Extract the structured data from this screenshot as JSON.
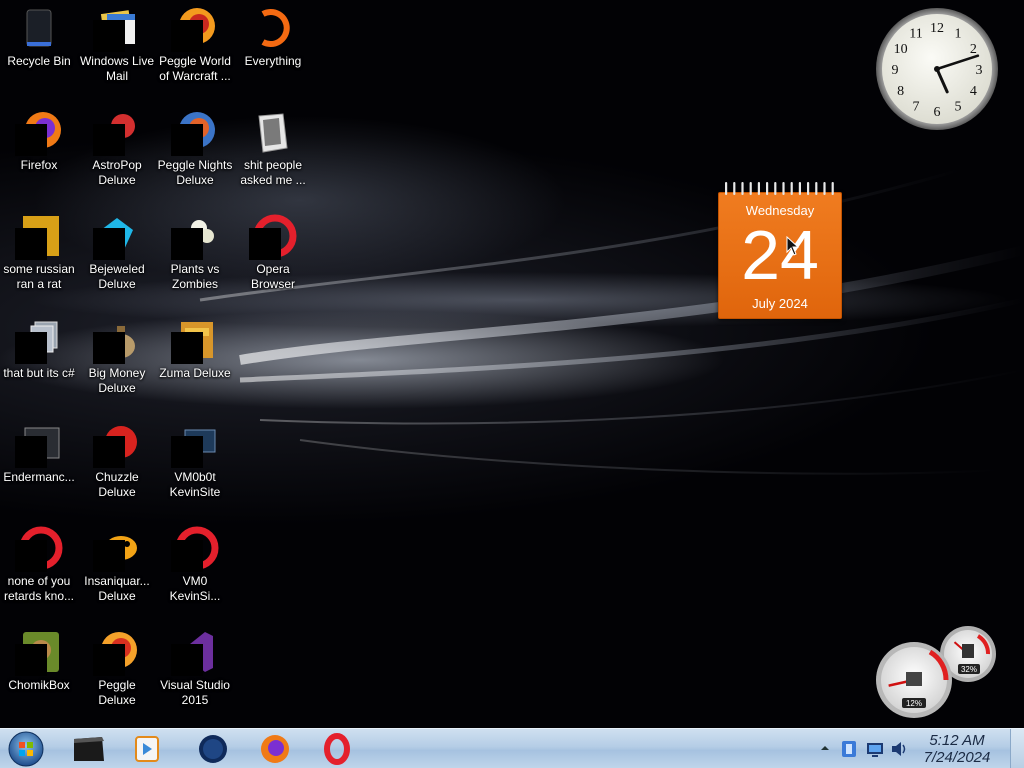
{
  "desktop": {
    "icons": [
      {
        "id": "recycle-bin",
        "label": "Recycle Bin"
      },
      {
        "id": "windows-live-mail",
        "label": "Windows Live Mail"
      },
      {
        "id": "peggle-world-of-warcraft",
        "label": "Peggle World of Warcraft ..."
      },
      {
        "id": "everything",
        "label": "Everything"
      },
      {
        "id": "firefox",
        "label": "Firefox"
      },
      {
        "id": "astropop-deluxe",
        "label": "AstroPop Deluxe"
      },
      {
        "id": "peggle-nights-deluxe",
        "label": "Peggle Nights Deluxe"
      },
      {
        "id": "shit-people-asked-me",
        "label": "shit people asked me ..."
      },
      {
        "id": "some-russian-ran-a-rat",
        "label": "some russian ran a rat"
      },
      {
        "id": "bejeweled-deluxe",
        "label": "Bejeweled Deluxe"
      },
      {
        "id": "plants-vs-zombies",
        "label": "Plants vs Zombies"
      },
      {
        "id": "opera-browser",
        "label": "Opera Browser"
      },
      {
        "id": "that-but-its-csharp",
        "label": "that but its c#"
      },
      {
        "id": "big-money-deluxe",
        "label": "Big Money Deluxe"
      },
      {
        "id": "zuma-deluxe",
        "label": "Zuma Deluxe"
      },
      {
        "id": "endermanch",
        "label": "Endermanc..."
      },
      {
        "id": "chuzzle-deluxe",
        "label": "Chuzzle Deluxe"
      },
      {
        "id": "vm0b0t-kevinsite",
        "label": "VM0b0t KevinSite"
      },
      {
        "id": "none-of-you-retards",
        "label": "none of you retards kno..."
      },
      {
        "id": "insaniquarium-deluxe",
        "label": "Insaniquar... Deluxe"
      },
      {
        "id": "vm0-kevinsi",
        "label": "VM0 KevinSi..."
      },
      {
        "id": "chomikbox",
        "label": "ChomikBox"
      },
      {
        "id": "peggle-deluxe",
        "label": "Peggle Deluxe"
      },
      {
        "id": "visual-studio-2015",
        "label": "Visual Studio 2015"
      }
    ]
  },
  "gadgets": {
    "clock": {
      "numerals": [
        "12",
        "1",
        "2",
        "3",
        "4",
        "5",
        "6",
        "7",
        "8",
        "9",
        "10",
        "11"
      ],
      "hour": 5,
      "minute": 12
    },
    "calendar": {
      "weekday": "Wednesday",
      "day": "24",
      "month_year": "July 2024"
    },
    "meter": {
      "cpu": "12%",
      "memory": "32%",
      "cpu_fraction": 0.12,
      "memory_fraction": 0.32
    }
  },
  "taskbar": {
    "pinned": [
      {
        "id": "terminal",
        "icon": "terminal-icon"
      },
      {
        "id": "media-player",
        "icon": "media-player-icon"
      },
      {
        "id": "globe-browser",
        "icon": "globe-icon"
      },
      {
        "id": "firefox",
        "icon": "firefox-icon"
      },
      {
        "id": "opera",
        "icon": "opera-icon"
      }
    ],
    "tray": {
      "time": "5:12 AM",
      "date": "7/24/2024"
    }
  },
  "colors": {
    "calendar_orange": "#e96d12",
    "taskbar_blue": "#b5cde6"
  }
}
